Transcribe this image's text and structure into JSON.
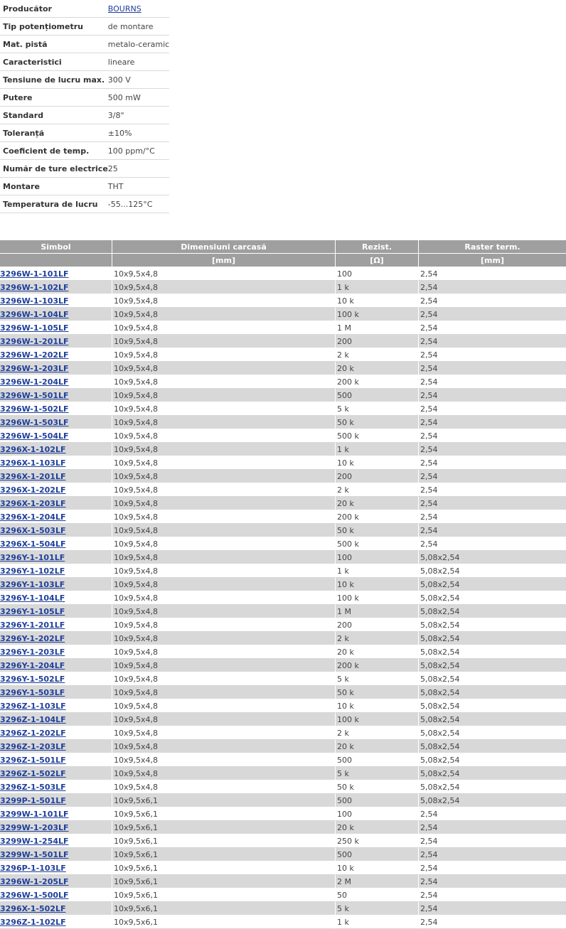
{
  "specs": [
    {
      "label": "Producător",
      "value": "BOURNS",
      "link": true
    },
    {
      "label": "Tip potențiometru",
      "value": "de montare"
    },
    {
      "label": "Mat. pistă",
      "value": "metalo-ceramic"
    },
    {
      "label": "Caracteristici",
      "value": "lineare"
    },
    {
      "label": "Tensiune de lucru max.",
      "value": "300 V"
    },
    {
      "label": "Putere",
      "value": "500 mW"
    },
    {
      "label": "Standard",
      "value": "3/8\""
    },
    {
      "label": "Toleranță",
      "value": "±10%"
    },
    {
      "label": "Coeficient de temp.",
      "value": "100 ppm/°C"
    },
    {
      "label": "Număr de ture electrice",
      "value": "25"
    },
    {
      "label": "Montare",
      "value": "THT"
    },
    {
      "label": "Temperatura de lucru",
      "value": "-55...125°C"
    }
  ],
  "table": {
    "headers": [
      "Simbol",
      "Dimensiuni carcasă",
      "Rezist.",
      "Raster term."
    ],
    "units": [
      "",
      "[mm]",
      "[Ω]",
      "[mm]"
    ],
    "rows": [
      [
        "3296W-1-101LF",
        "10x9,5x4,8",
        "100",
        "2,54"
      ],
      [
        "3296W-1-102LF",
        "10x9,5x4,8",
        "1 k",
        "2,54"
      ],
      [
        "3296W-1-103LF",
        "10x9,5x4,8",
        "10 k",
        "2,54"
      ],
      [
        "3296W-1-104LF",
        "10x9,5x4,8",
        "100 k",
        "2,54"
      ],
      [
        "3296W-1-105LF",
        "10x9,5x4,8",
        "1 M",
        "2,54"
      ],
      [
        "3296W-1-201LF",
        "10x9,5x4,8",
        "200",
        "2,54"
      ],
      [
        "3296W-1-202LF",
        "10x9,5x4,8",
        "2 k",
        "2,54"
      ],
      [
        "3296W-1-203LF",
        "10x9,5x4,8",
        "20 k",
        "2,54"
      ],
      [
        "3296W-1-204LF",
        "10x9,5x4,8",
        "200 k",
        "2,54"
      ],
      [
        "3296W-1-501LF",
        "10x9,5x4,8",
        "500",
        "2,54"
      ],
      [
        "3296W-1-502LF",
        "10x9,5x4,8",
        "5 k",
        "2,54"
      ],
      [
        "3296W-1-503LF",
        "10x9,5x4,8",
        "50 k",
        "2,54"
      ],
      [
        "3296W-1-504LF",
        "10x9,5x4,8",
        "500 k",
        "2,54"
      ],
      [
        "3296X-1-102LF",
        "10x9,5x4,8",
        "1 k",
        "2,54"
      ],
      [
        "3296X-1-103LF",
        "10x9,5x4,8",
        "10 k",
        "2,54"
      ],
      [
        "3296X-1-201LF",
        "10x9,5x4,8",
        "200",
        "2,54"
      ],
      [
        "3296X-1-202LF",
        "10x9,5x4,8",
        "2 k",
        "2,54"
      ],
      [
        "3296X-1-203LF",
        "10x9,5x4,8",
        "20 k",
        "2,54"
      ],
      [
        "3296X-1-204LF",
        "10x9,5x4,8",
        "200 k",
        "2,54"
      ],
      [
        "3296X-1-503LF",
        "10x9,5x4,8",
        "50 k",
        "2,54"
      ],
      [
        "3296X-1-504LF",
        "10x9,5x4,8",
        "500 k",
        "2,54"
      ],
      [
        "3296Y-1-101LF",
        "10x9,5x4,8",
        "100",
        "5,08x2,54"
      ],
      [
        "3296Y-1-102LF",
        "10x9,5x4,8",
        "1 k",
        "5,08x2,54"
      ],
      [
        "3296Y-1-103LF",
        "10x9,5x4,8",
        "10 k",
        "5,08x2,54"
      ],
      [
        "3296Y-1-104LF",
        "10x9,5x4,8",
        "100 k",
        "5,08x2,54"
      ],
      [
        "3296Y-1-105LF",
        "10x9,5x4,8",
        "1 M",
        "5,08x2,54"
      ],
      [
        "3296Y-1-201LF",
        "10x9,5x4,8",
        "200",
        "5,08x2,54"
      ],
      [
        "3296Y-1-202LF",
        "10x9,5x4,8",
        "2 k",
        "5,08x2,54"
      ],
      [
        "3296Y-1-203LF",
        "10x9,5x4,8",
        "20 k",
        "5,08x2,54"
      ],
      [
        "3296Y-1-204LF",
        "10x9,5x4,8",
        "200 k",
        "5,08x2,54"
      ],
      [
        "3296Y-1-502LF",
        "10x9,5x4,8",
        "5 k",
        "5,08x2,54"
      ],
      [
        "3296Y-1-503LF",
        "10x9,5x4,8",
        "50 k",
        "5,08x2,54"
      ],
      [
        "3296Z-1-103LF",
        "10x9,5x4,8",
        "10 k",
        "5,08x2,54"
      ],
      [
        "3296Z-1-104LF",
        "10x9,5x4,8",
        "100 k",
        "5,08x2,54"
      ],
      [
        "3296Z-1-202LF",
        "10x9,5x4,8",
        "2 k",
        "5,08x2,54"
      ],
      [
        "3296Z-1-203LF",
        "10x9,5x4,8",
        "20 k",
        "5,08x2,54"
      ],
      [
        "3296Z-1-501LF",
        "10x9,5x4,8",
        "500",
        "5,08x2,54"
      ],
      [
        "3296Z-1-502LF",
        "10x9,5x4,8",
        "5 k",
        "5,08x2,54"
      ],
      [
        "3296Z-1-503LF",
        "10x9,5x4,8",
        "50 k",
        "5,08x2,54"
      ],
      [
        "3299P-1-501LF",
        "10x9,5x6,1",
        "500",
        "5,08x2,54"
      ],
      [
        "3299W-1-101LF",
        "10x9,5x6,1",
        "100",
        "2,54"
      ],
      [
        "3299W-1-203LF",
        "10x9,5x6,1",
        "20 k",
        "2,54"
      ],
      [
        "3299W-1-254LF",
        "10x9,5x6,1",
        "250 k",
        "2,54"
      ],
      [
        "3299W-1-501LF",
        "10x9,5x6,1",
        "500",
        "2,54"
      ],
      [
        "3296P-1-103LF",
        "10x9,5x6,1",
        "10 k",
        "2,54"
      ],
      [
        "3296W-1-205LF",
        "10x9,5x6,1",
        "2 M",
        "2,54"
      ],
      [
        "3296W-1-500LF",
        "10x9,5x6,1",
        "50",
        "2,54"
      ],
      [
        "3296X-1-502LF",
        "10x9,5x6,1",
        "5 k",
        "2,54"
      ],
      [
        "3296Z-1-102LF",
        "10x9,5x6,1",
        "1 k",
        "2,54"
      ]
    ]
  }
}
